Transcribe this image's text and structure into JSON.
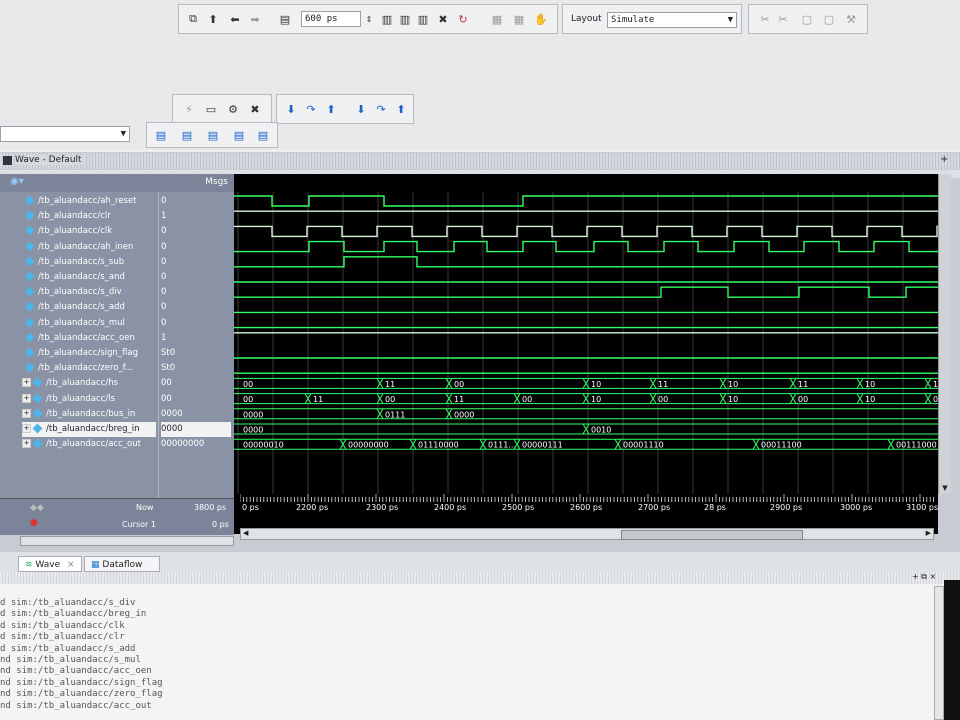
{
  "toolbar": {
    "time_value": "600",
    "time_unit": "ps",
    "layout_label": "Layout",
    "layout_value": "Simulate"
  },
  "wave_window": {
    "title": "Wave - Default",
    "msgs_header": "Msgs",
    "signals": [
      {
        "name": "/tb_aluandacc/ah_reset",
        "value": "0",
        "kind": "bit"
      },
      {
        "name": "/tb_aluandacc/clr",
        "value": "1",
        "kind": "bit"
      },
      {
        "name": "/tb_aluandacc/clk",
        "value": "0",
        "kind": "bit"
      },
      {
        "name": "/tb_aluandacc/ah_inen",
        "value": "0",
        "kind": "bit"
      },
      {
        "name": "/tb_aluandacc/s_sub",
        "value": "0",
        "kind": "bit"
      },
      {
        "name": "/tb_aluandacc/s_and",
        "value": "0",
        "kind": "bit"
      },
      {
        "name": "/tb_aluandacc/s_div",
        "value": "0",
        "kind": "bit"
      },
      {
        "name": "/tb_aluandacc/s_add",
        "value": "0",
        "kind": "bit"
      },
      {
        "name": "/tb_aluandacc/s_mul",
        "value": "0",
        "kind": "bit"
      },
      {
        "name": "/tb_aluandacc/acc_oen",
        "value": "1",
        "kind": "bit"
      },
      {
        "name": "/tb_aluandacc/sign_flag",
        "value": "St0",
        "kind": "bit"
      },
      {
        "name": "/tb_aluandacc/zero_f...",
        "value": "St0",
        "kind": "bit"
      },
      {
        "name": "/tb_aluandacc/hs",
        "value": "00",
        "kind": "bus"
      },
      {
        "name": "/tb_aluandacc/ls",
        "value": "00",
        "kind": "bus"
      },
      {
        "name": "/tb_aluandacc/bus_in",
        "value": "0000",
        "kind": "bus"
      },
      {
        "name": "/tb_aluandacc/breg_in",
        "value": "0000",
        "kind": "bus"
      },
      {
        "name": "/tb_aluandacc/acc_out",
        "value": "00000000",
        "kind": "bus"
      }
    ],
    "bus_labels": {
      "hs": [
        [
          "00",
          240
        ],
        [
          "11",
          382
        ],
        [
          "00",
          451
        ],
        [
          "10",
          588
        ],
        [
          "11",
          655
        ],
        [
          "10",
          725
        ],
        [
          "11",
          795
        ],
        [
          "10",
          862
        ],
        [
          "11",
          930
        ]
      ],
      "ls": [
        [
          "00",
          240
        ],
        [
          "11",
          310
        ],
        [
          "00",
          382
        ],
        [
          "11",
          451
        ],
        [
          "00",
          519
        ],
        [
          "10",
          588
        ],
        [
          "00",
          655
        ],
        [
          "10",
          725
        ],
        [
          "00",
          795
        ],
        [
          "10",
          862
        ],
        [
          "00",
          930
        ]
      ],
      "bus_in": [
        [
          "0000",
          240
        ],
        [
          "0111",
          382
        ],
        [
          "0000",
          451
        ]
      ],
      "breg_in": [
        [
          "0000",
          240
        ],
        [
          "0010",
          588
        ]
      ],
      "acc_out": [
        [
          "00000010",
          240
        ],
        [
          "00000000",
          345
        ],
        [
          "01110000",
          415
        ],
        [
          "0111...",
          485
        ],
        [
          "00000111",
          519
        ],
        [
          "00001110",
          620
        ],
        [
          "00011100",
          758
        ],
        [
          "00111000",
          893
        ]
      ]
    },
    "now_label": "Now",
    "now_value": "3800 ps",
    "cursor_label": "Cursor 1",
    "cursor_value": "0 ps",
    "timeline_ticks": [
      "0 ps",
      "2200 ps",
      "2300 ps",
      "2400 ps",
      "2500 ps",
      "2600 ps",
      "2700 ps",
      "28 ps",
      "2900 ps",
      "3000 ps",
      "3100 ps"
    ]
  },
  "tabs": [
    {
      "label": "Wave"
    },
    {
      "label": "Dataflow"
    }
  ],
  "transcript": [
    "d  sim:/tb_aluandacc/s_div",
    "d  sim:/tb_aluandacc/breg_in",
    "d  sim:/tb_aluandacc/clk",
    "d  sim:/tb_aluandacc/clr",
    "d  sim:/tb_aluandacc/s_add",
    "nd  sim:/tb_aluandacc/s_mul",
    "nd  sim:/tb_aluandacc/acc_oen",
    "nd  sim:/tb_aluandacc/sign_flag",
    "nd  sim:/tb_aluandacc/zero_flag",
    "nd  sim:/tb_aluandacc/acc_out"
  ],
  "colors": {
    "wave_bg": "#000000",
    "wave_line": "#33ff66",
    "wave_line_light": "#d7f5d7",
    "name_panel": "#8a93a6",
    "accent": "#1e5fd0"
  }
}
